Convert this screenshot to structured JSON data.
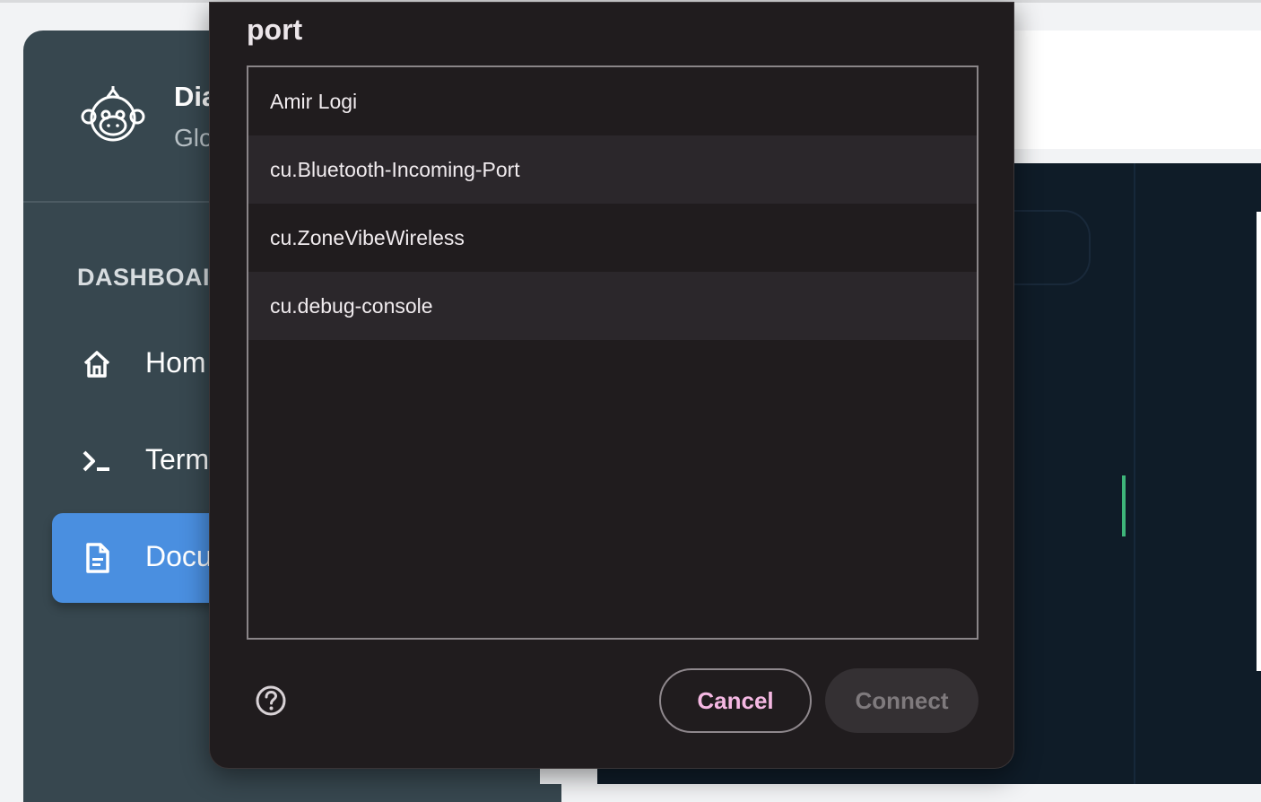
{
  "app": {
    "name": "Dia",
    "subtitle": "Glo",
    "section_title": "DASHBOAI",
    "nav": [
      {
        "label": "Hom",
        "icon": "home-icon",
        "active": false
      },
      {
        "label": "Term",
        "icon": "terminal-icon",
        "active": false
      },
      {
        "label": "Docu",
        "icon": "document-icon",
        "active": true
      }
    ],
    "colors": {
      "sidebar_bg": "#37474f",
      "active_nav": "#4a8fe0",
      "dark_panel": "#0f1c28",
      "status_green": "#3eb57a"
    }
  },
  "dialog": {
    "title": "port",
    "ports": [
      "Amir Logi",
      "cu.Bluetooth-Incoming-Port",
      "cu.ZoneVibeWireless",
      "cu.debug-console"
    ],
    "help_icon": "help-circle-icon",
    "cancel_label": "Cancel",
    "connect_label": "Connect",
    "colors": {
      "background": "#201c1e",
      "cancel_text": "#f5b8e3",
      "connect_bg": "#343033"
    }
  }
}
